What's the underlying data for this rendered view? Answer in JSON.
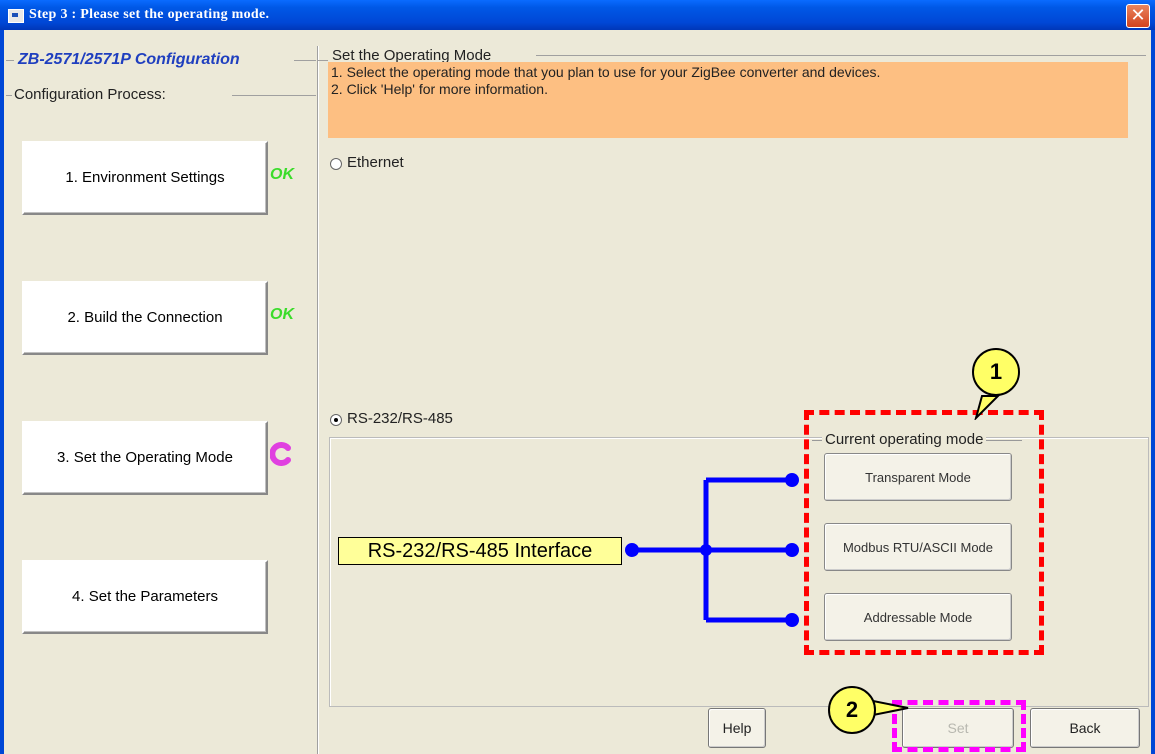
{
  "window": {
    "title": "Step 3 :  Please set the operating mode.",
    "close_glyph": "✕"
  },
  "left": {
    "title": "ZB-2571/2571P Configuration",
    "process_label": "Configuration Process:",
    "steps": [
      {
        "label": "1. Environment Settings",
        "status": "OK"
      },
      {
        "label": "2. Build the Connection",
        "status": "OK"
      },
      {
        "label": "3. Set the Operating Mode",
        "status_icon": "in-progress-icon"
      },
      {
        "label": "4. Set the Parameters"
      }
    ]
  },
  "main": {
    "section_label": "Set the Operating Mode",
    "info_lines": [
      "1. Select the operating mode that you plan to use for your ZigBee converter and devices.",
      "2. Click 'Help' for more information."
    ],
    "options": [
      {
        "label": "Ethernet",
        "selected": false
      },
      {
        "label": "RS-232/RS-485",
        "selected": true
      }
    ],
    "interface_label": "RS-232/RS-485 Interface",
    "current_mode_label": "Current operating mode",
    "modes": [
      "Transparent Mode",
      "Modbus RTU/ASCII Mode",
      "Addressable Mode"
    ]
  },
  "buttons": {
    "help": "Help",
    "set": "Set",
    "back": "Back"
  },
  "annotations": {
    "marker1": "1",
    "marker2": "2"
  },
  "colors": {
    "titlebar": "#0054e3",
    "info_bg": "#fdbf82",
    "ok": "#3bdc2b",
    "wire": "#0000ff",
    "annotation1": "#ff0000",
    "annotation2": "#ff00ff",
    "marker_bg": "#ffff66"
  }
}
